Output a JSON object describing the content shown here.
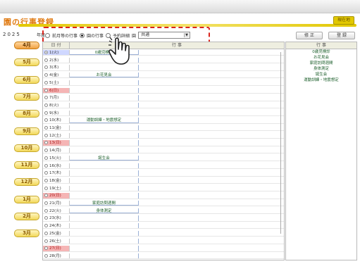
{
  "app": {
    "title": "園の行事登録",
    "exit_label": "現在地"
  },
  "toolbar": {
    "year": "2025",
    "year_suffix": "年度",
    "filters": [
      {
        "label": "前月等の行事",
        "selected": false
      },
      {
        "label": "園の行事",
        "selected": true
      },
      {
        "label": "予約詳細",
        "selected": false
      }
    ],
    "school_label": "園",
    "school_value": "共通",
    "edit_label": "修 正",
    "register_label": "登 録"
  },
  "months": [
    "4月",
    "5月",
    "6月",
    "7月",
    "8月",
    "9月",
    "10月",
    "11月",
    "12月",
    "1月",
    "2月",
    "3月"
  ],
  "active_month": "4月",
  "grid": {
    "date_header": "日 付",
    "event_header": "行 事",
    "rows": [
      {
        "date": "1(火)",
        "event": "0歳児検診",
        "type": "sel"
      },
      {
        "date": "2(水)",
        "event": ""
      },
      {
        "date": "3(木)",
        "event": ""
      },
      {
        "date": "4(金)",
        "event": "お花見会"
      },
      {
        "date": "5(土)",
        "event": ""
      },
      {
        "date": "6(日)",
        "event": "",
        "type": "hol"
      },
      {
        "date": "7(月)",
        "event": ""
      },
      {
        "date": "8(火)",
        "event": ""
      },
      {
        "date": "9(水)",
        "event": ""
      },
      {
        "date": "10(木)",
        "event": "運動訓練・地震想定"
      },
      {
        "date": "11(金)",
        "event": ""
      },
      {
        "date": "12(土)",
        "event": ""
      },
      {
        "date": "13(日)",
        "event": "",
        "type": "hol"
      },
      {
        "date": "14(月)",
        "event": ""
      },
      {
        "date": "15(火)",
        "event": "誕生会"
      },
      {
        "date": "16(水)",
        "event": ""
      },
      {
        "date": "17(木)",
        "event": ""
      },
      {
        "date": "18(金)",
        "event": ""
      },
      {
        "date": "19(土)",
        "event": ""
      },
      {
        "date": "20(日)",
        "event": "",
        "type": "hol"
      },
      {
        "date": "21(月)",
        "event": "家庭訪問週間"
      },
      {
        "date": "22(火)",
        "event": "身体測定"
      },
      {
        "date": "23(水)",
        "event": ""
      },
      {
        "date": "24(木)",
        "event": ""
      },
      {
        "date": "25(金)",
        "event": ""
      },
      {
        "date": "26(土)",
        "event": ""
      },
      {
        "date": "27(日)",
        "event": "",
        "type": "hol"
      },
      {
        "date": "28(月)",
        "event": ""
      }
    ]
  },
  "events_panel": {
    "header": "行 事",
    "items": [
      "0歳児検診",
      "お花見会",
      "家庭訪問週間",
      "身体測定",
      "誕生会",
      "運動訓練・地震想定"
    ]
  },
  "colors": {
    "title": "#e07a12",
    "title_bar": "#e2c800",
    "highlight": "#d9241c",
    "holiday_row": "#f5b5b5",
    "event_text": "#1b5e2a"
  },
  "cursor_icon": "hand-pointer-icon"
}
